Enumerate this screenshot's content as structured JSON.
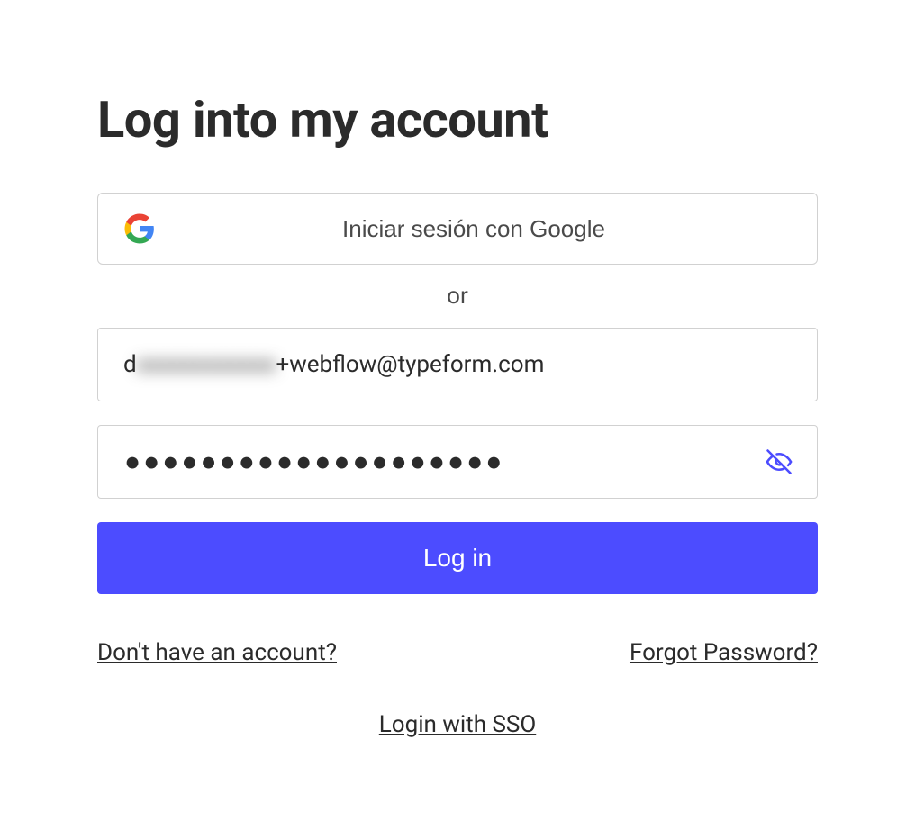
{
  "title": "Log into my account",
  "google_button": {
    "label": "Iniciar sesión con Google"
  },
  "divider": "or",
  "email": {
    "prefix": "d",
    "blurred": "xxxxxxxxxxxx",
    "suffix": "+webflow@typeform.com"
  },
  "password": {
    "masked": "●●●●●●●●●●●●●●●●●●●●"
  },
  "login_button": "Log in",
  "links": {
    "signup": "Don't have an account?",
    "forgot": "Forgot Password?",
    "sso": "Login with SSO"
  }
}
